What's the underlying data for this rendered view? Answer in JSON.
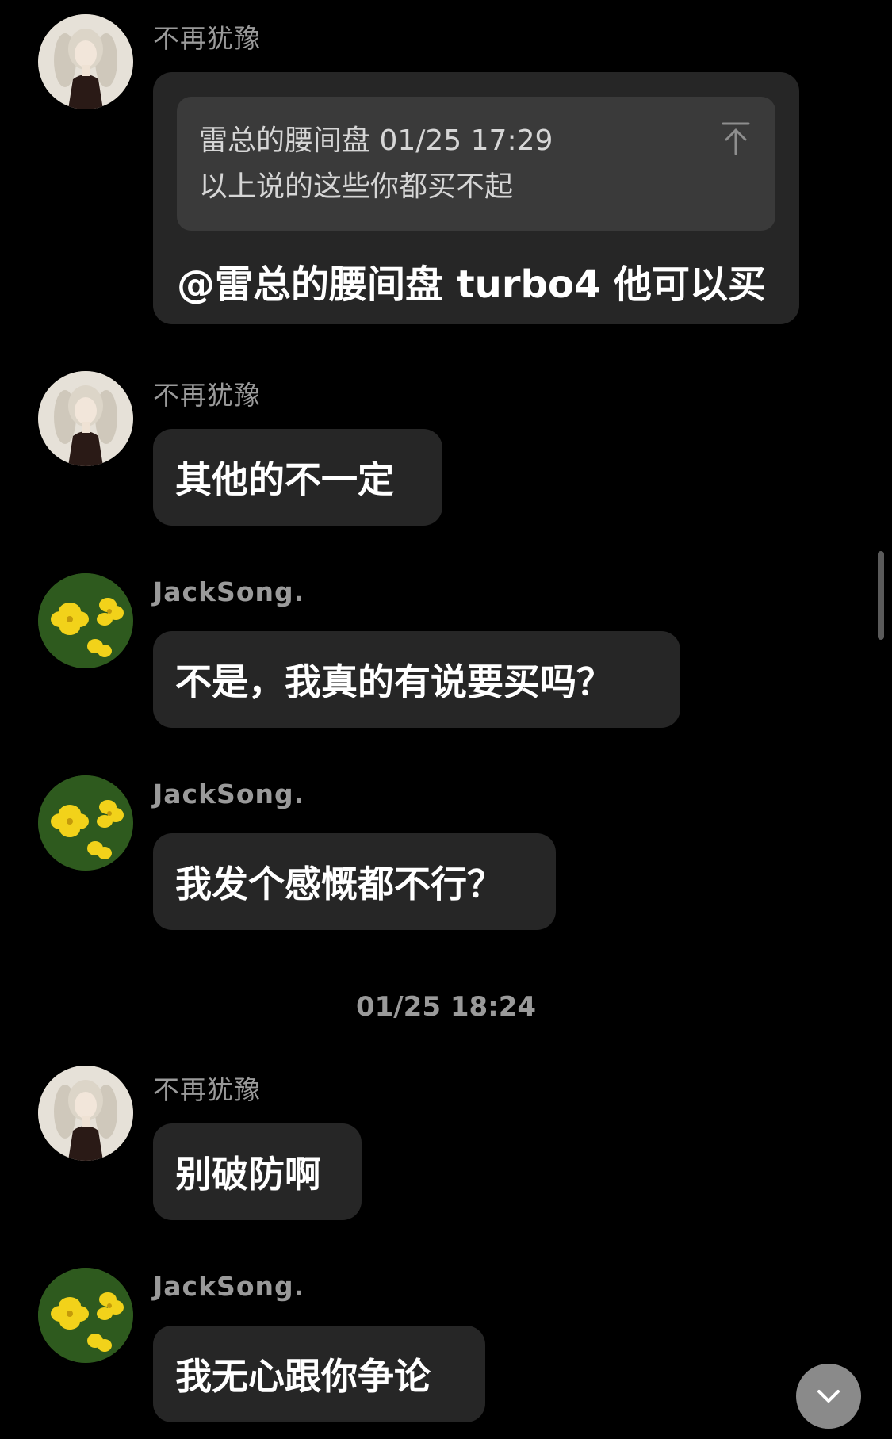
{
  "messages": [
    {
      "sender": "不再犹豫",
      "quote": {
        "meta": "雷总的腰间盘 01/25 17:29",
        "text": "以上说的这些你都买不起"
      },
      "text": "@雷总的腰间盘 turbo4 他可以买"
    },
    {
      "sender": "不再犹豫",
      "text": "其他的不一定"
    },
    {
      "sender": "JackSong.",
      "text": "不是，我真的有说要买吗？"
    },
    {
      "sender": "JackSong.",
      "text": "我发个感慨都不行？"
    },
    {
      "sender": "不再犹豫",
      "text": "别破防啊"
    },
    {
      "sender": "JackSong.",
      "text": "我无心跟你争论"
    }
  ],
  "timestamp": "01/25 18:24",
  "icons": {
    "quote_jump": "arrow-up-to-top-icon",
    "scroll_down": "chevron-down-icon",
    "avatar_1": "anime-girl-avatar",
    "avatar_2": "yellow-flower-avatar"
  },
  "colors": {
    "background": "#000000",
    "bubble": "#262626",
    "quote_box": "#3a3a3a",
    "sender_text": "#9a9a9a"
  }
}
